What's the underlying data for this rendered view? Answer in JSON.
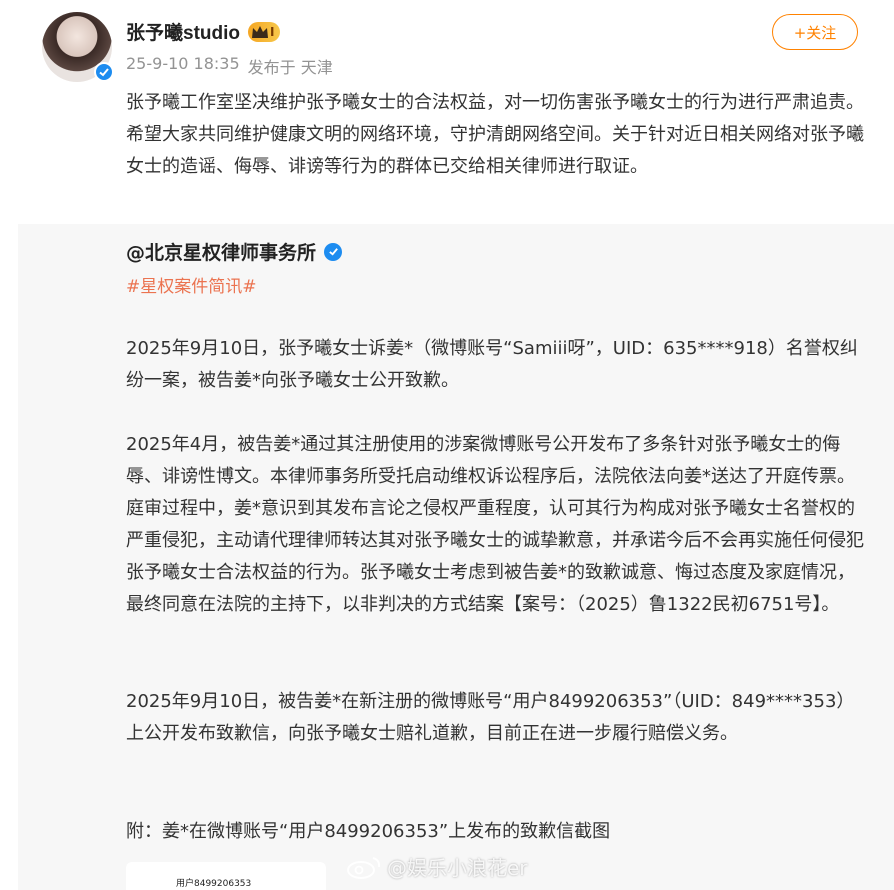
{
  "user": {
    "name": "张予曦studio",
    "vip_level": "I",
    "time": "25-9-10 18:35",
    "source": "发布于 天津"
  },
  "follow": {
    "label": "+关注"
  },
  "post": {
    "text": "张予曦工作室坚决维护张予曦女士的合法权益，对一切伤害张予曦女士的行为进行严肃追责。希望大家共同维护健康文明的网络环境，守护清朗网络空间。关于针对近日相关网络对张予曦女士的造谣、侮辱、诽谤等行为的群体已交给相关律师进行取证。"
  },
  "repost": {
    "author": "@北京星权律师事务所",
    "topic": "#星权案件简讯#",
    "paragraphs": [
      "2025年9月10日，张予曦女士诉姜*（微博账号“Samiii呀”，UID：635****918）名誉权纠纷一案，被告姜*向张予曦女士公开致歉。",
      "2025年4月，被告姜*通过其注册使用的涉案微博账号公开发布了多条针对张予曦女士的侮辱、诽谤性博文。本律师事务所受托启动维权诉讼程序后，法院依法向姜*送达了开庭传票。庭审过程中，姜*意识到其发布言论之侵权严重程度，认可其行为构成对张予曦女士名誉权的严重侵犯，主动请代理律师转达其对张予曦女士的诚挚歉意，并承诺今后不会再实施任何侵犯张予曦女士合法权益的行为。张予曦女士考虑到被告姜*的致歉诚意、悔过态度及家庭情况，最终同意在法院的主持下，以非判决的方式结案【案号：（2025）鲁1322民初6751号】。",
      "2025年9月10日，被告姜*在新注册的微博账号“用户8499206353”（UID：849****353）上公开发布致歉信，向张予曦女士赔礼道歉，目前正在进一步履行赔偿义务。",
      "附：姜*在微博账号“用户8499206353”上发布的致歉信截图"
    ],
    "attachment_caption": "用户8499206353"
  },
  "watermark": {
    "text": "@娱乐小浪花er"
  },
  "colors": {
    "accent": "#ff8200",
    "topic": "#eb7350",
    "verified": "#1d8cf0"
  }
}
